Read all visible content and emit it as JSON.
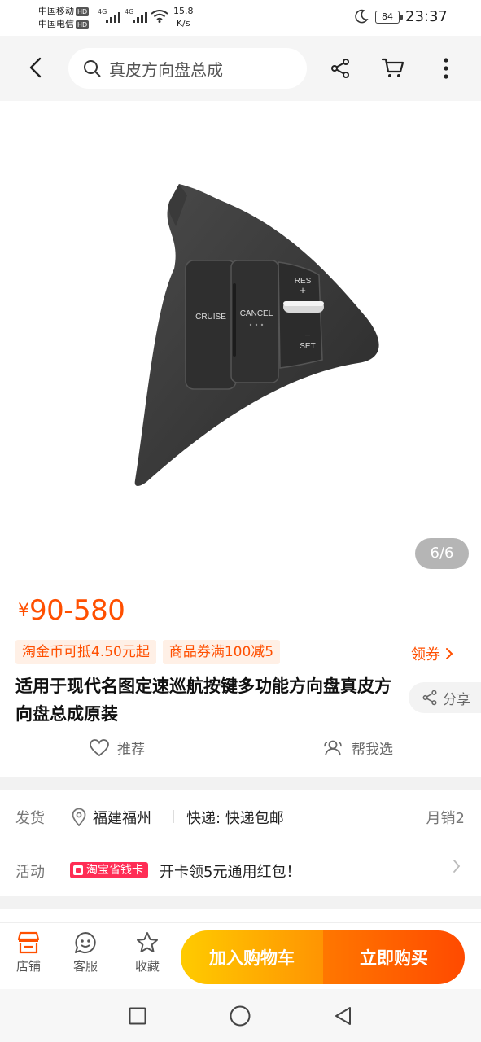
{
  "status_bar": {
    "carrier1": "中国移动",
    "carrier2": "中国电信",
    "hd": "HD",
    "network1": "4G",
    "network2": "4G",
    "speed_value": "15.8",
    "speed_unit": "K/s",
    "battery": "84",
    "time": "23:37"
  },
  "navbar": {
    "search_text": "真皮方向盘总成",
    "icons": [
      "back-icon",
      "search-icon",
      "share-icon",
      "cart-icon",
      "more-icon"
    ]
  },
  "gallery": {
    "counter": "6/6",
    "product_labels": {
      "cruise": "CRUISE",
      "cancel": "CANCEL",
      "res": "RES",
      "plus": "+",
      "minus": "−",
      "set": "SET"
    }
  },
  "price": {
    "currency": "¥",
    "range": "90-580"
  },
  "coupons": {
    "items": [
      "淘金币可抵4.50元起",
      "商品券满100减5"
    ],
    "get_label": "领券"
  },
  "product": {
    "title": "适用于现代名图定速巡航按键多功能方向盘真皮方向盘总成原装",
    "share_label": "分享",
    "recommend_label": "推荐",
    "help_choose_label": "帮我选"
  },
  "shipping": {
    "label": "发货",
    "location": "福建福州",
    "express": "快递: 快递包邮",
    "monthly_sales": "月销2"
  },
  "promotion": {
    "label": "活动",
    "badge": "淘宝省钱卡",
    "text": "开卡领5元通用红包！"
  },
  "bottom_bar": {
    "store_label": "店铺",
    "service_label": "客服",
    "favorite_label": "收藏",
    "add_to_cart": "加入购物车",
    "buy_now": "立即购买"
  },
  "colors": {
    "accent": "#ff4f00",
    "cart_start": "#ffcb00",
    "buy_end": "#ff4a00",
    "promo_badge": "#ff2d55"
  }
}
